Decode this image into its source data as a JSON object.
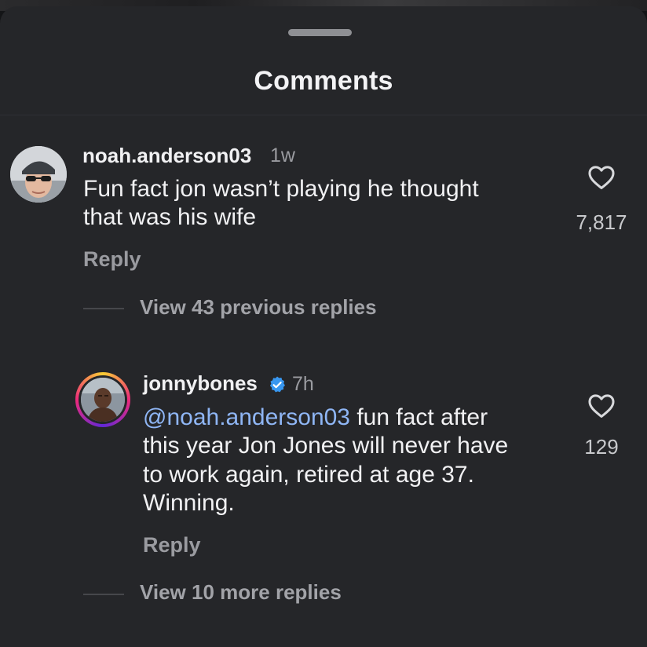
{
  "sheet": {
    "title": "Comments"
  },
  "comments": [
    {
      "username": "noah.anderson03",
      "time": "1w",
      "text_lines": [
        "Fun fact jon wasn’t playing he thought",
        "that was his wife"
      ],
      "likes": "7,817",
      "reply_label": "Reply",
      "avatar": "profile-photo-sunglasses"
    },
    {
      "username": "jonnybones",
      "verified": true,
      "time": "7h",
      "mention": "@noah.anderson03",
      "text_lines": [
        " fun fact after",
        "this year Jon Jones will never have",
        "to work again, retired at age 37.",
        "Winning."
      ],
      "likes": "129",
      "reply_label": "Reply",
      "avatar": "profile-photo-story-ring"
    }
  ],
  "threads": {
    "view_previous": "View 43 previous replies",
    "view_more": "View 10 more replies"
  },
  "icons": {
    "like": "heart-outline-icon",
    "verified": "verified-badge-icon",
    "grabber": "drag-handle"
  },
  "colors": {
    "sheet_bg": "#252629",
    "text_primary": "#f1f1f3",
    "text_secondary": "#9a9ba0",
    "mention": "#8fb6f5",
    "verified_blue": "#3897f0"
  }
}
